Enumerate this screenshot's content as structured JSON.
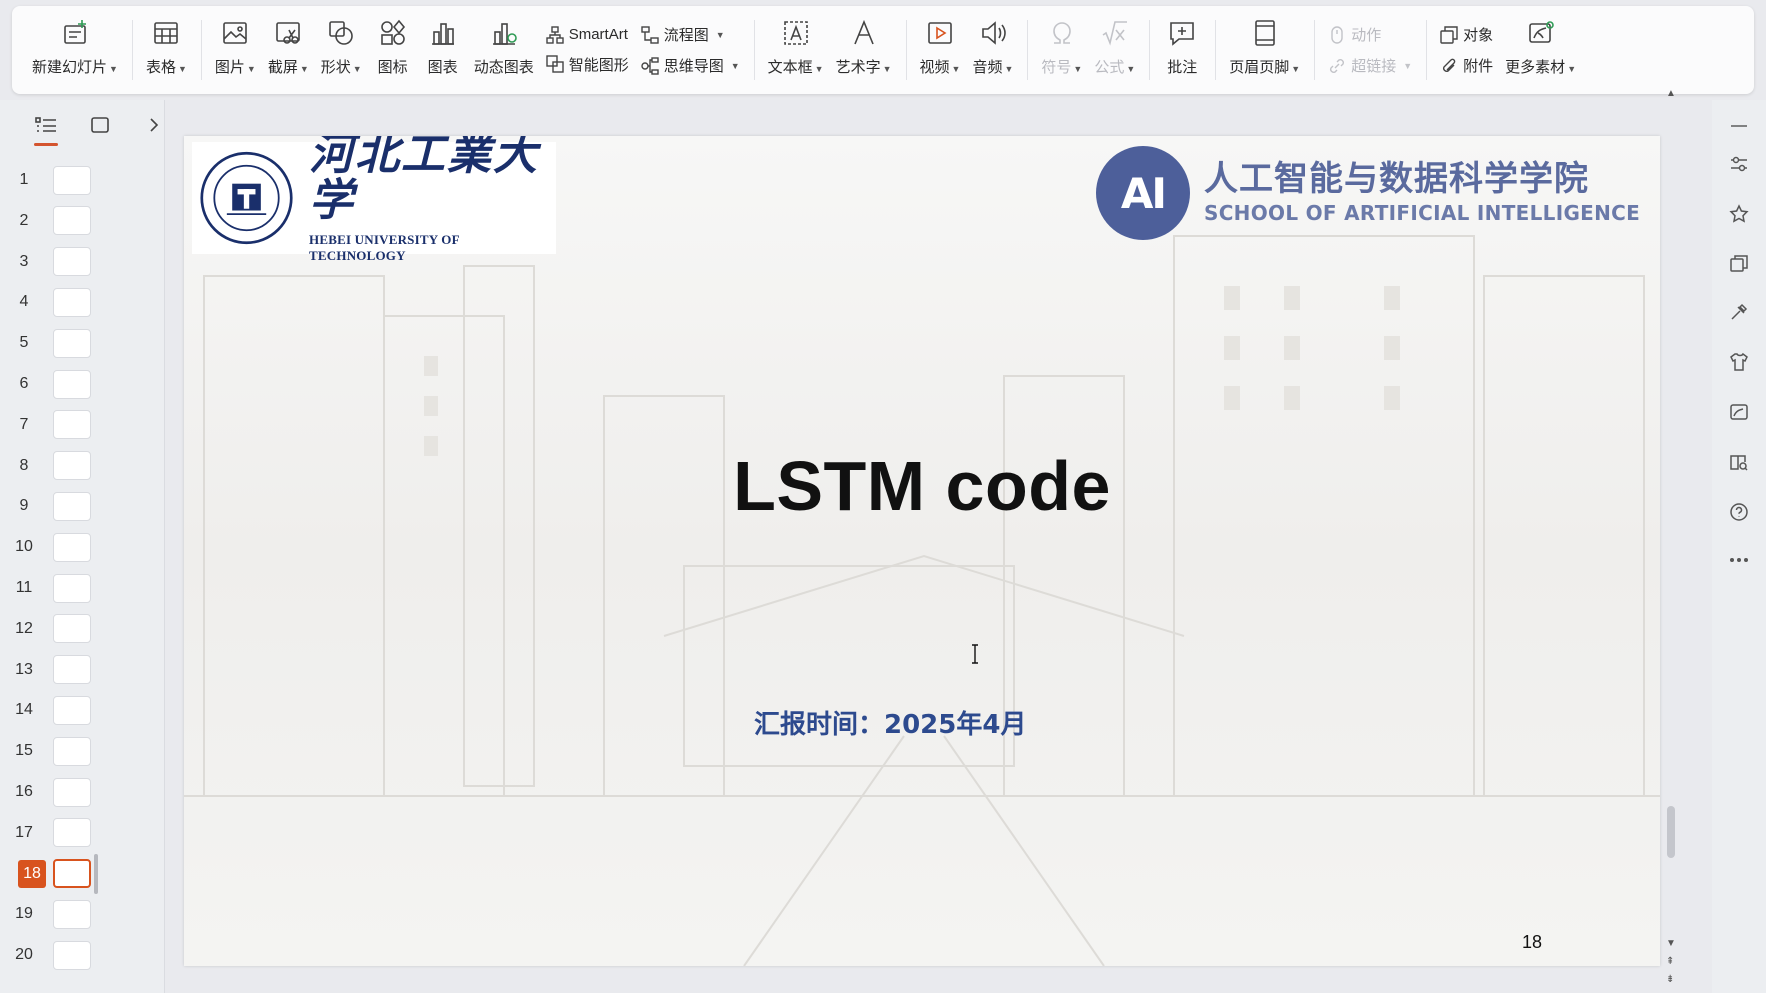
{
  "ribbon": {
    "new_slide": "新建幻灯片",
    "table": "表格",
    "picture": "图片",
    "screenshot": "截屏",
    "shape": "形状",
    "icon": "图标",
    "chart": "图表",
    "dynamic_chart": "动态图表",
    "smartart": "SmartArt",
    "smart_graphic": "智能图形",
    "flowchart": "流程图",
    "mindmap": "思维导图",
    "textbox": "文本框",
    "wordart": "艺术字",
    "video": "视频",
    "audio": "音频",
    "symbol": "符号",
    "formula": "公式",
    "comment": "批注",
    "header_footer": "页眉页脚",
    "action": "动作",
    "hyperlink": "超链接",
    "object": "对象",
    "attachment": "附件",
    "more_materials": "更多素材"
  },
  "thumbnails": {
    "active": 18,
    "numbers": [
      "1",
      "2",
      "3",
      "4",
      "5",
      "6",
      "7",
      "8",
      "9",
      "10",
      "11",
      "12",
      "13",
      "14",
      "15",
      "16",
      "17",
      "18",
      "19",
      "20"
    ]
  },
  "slide": {
    "logo_left_cn": "河北工業大学",
    "logo_left_en": "HEBEI UNIVERSITY OF TECHNOLOGY",
    "logo_right_badge": "AI",
    "logo_right_cn": "人工智能与数据科学学院",
    "logo_right_en": "SCHOOL OF ARTIFICIAL INTELLIGENCE",
    "title": "LSTM code",
    "date": "汇报时间：2025年4月",
    "page_number": "18"
  },
  "colors": {
    "accent": "#d8531e",
    "logo_navy": "#1a2f6b",
    "ai_blue": "#4d5f9a",
    "date_blue": "#2d4a8e"
  }
}
